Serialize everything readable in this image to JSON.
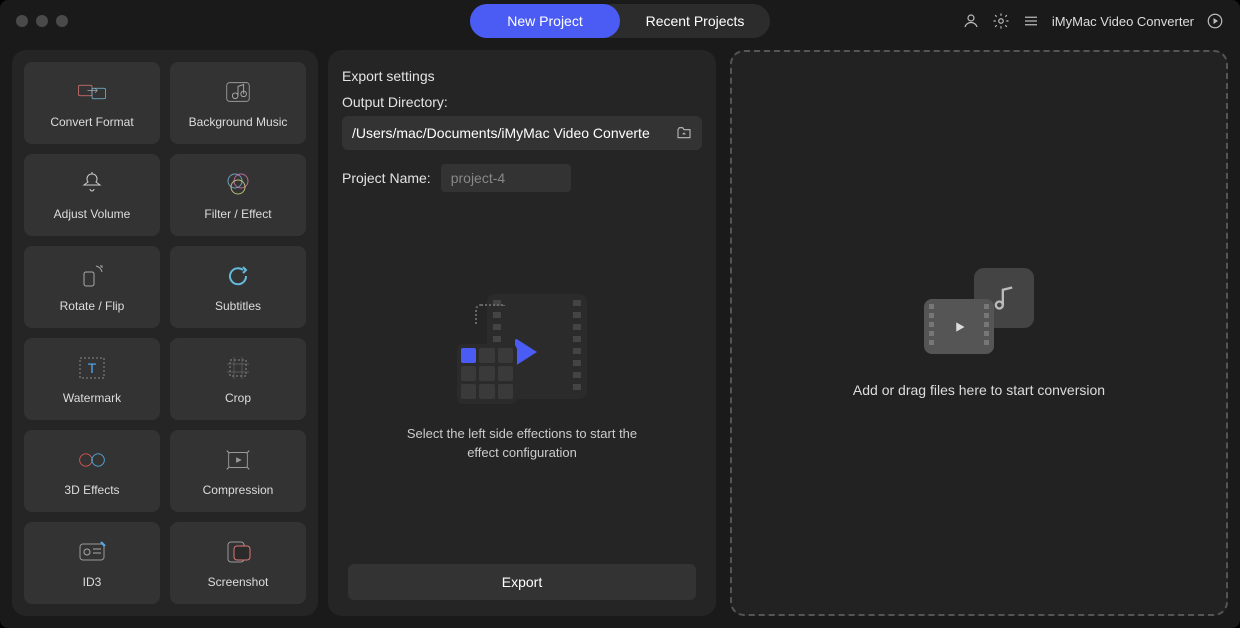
{
  "app_name": "iMyMac Video Converter",
  "tabs": {
    "new": "New Project",
    "recent": "Recent Projects"
  },
  "tools": [
    {
      "id": "convert-format",
      "label": "Convert Format"
    },
    {
      "id": "background-music",
      "label": "Background Music"
    },
    {
      "id": "adjust-volume",
      "label": "Adjust Volume"
    },
    {
      "id": "filter-effect",
      "label": "Filter / Effect"
    },
    {
      "id": "rotate-flip",
      "label": "Rotate / Flip"
    },
    {
      "id": "subtitles",
      "label": "Subtitles"
    },
    {
      "id": "watermark",
      "label": "Watermark"
    },
    {
      "id": "crop",
      "label": "Crop"
    },
    {
      "id": "3d-effects",
      "label": "3D Effects"
    },
    {
      "id": "compression",
      "label": "Compression"
    },
    {
      "id": "id3",
      "label": "ID3"
    },
    {
      "id": "screenshot",
      "label": "Screenshot"
    }
  ],
  "export": {
    "title": "Export settings",
    "output_dir_label": "Output Directory:",
    "output_dir": "/Users/mac/Documents/iMyMac Video Converte",
    "project_name_label": "Project Name:",
    "project_name_placeholder": "project-4",
    "hint": "Select the left side effections to start the effect configuration",
    "button": "Export"
  },
  "dropzone": "Add or drag files here to start conversion"
}
